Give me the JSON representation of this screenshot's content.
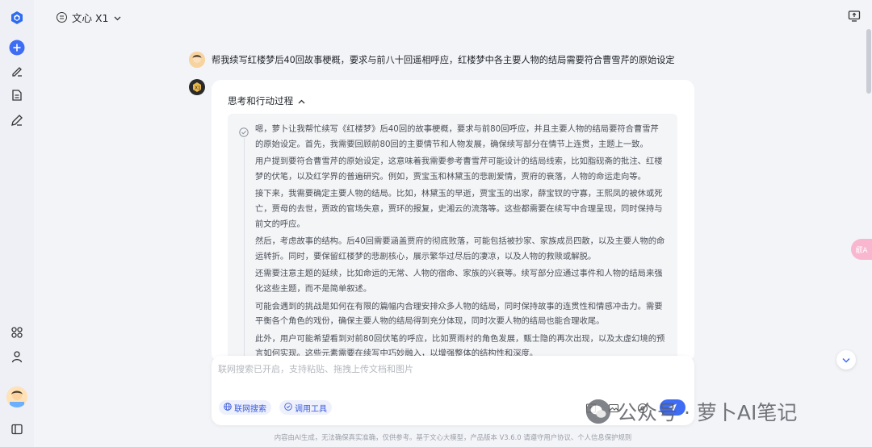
{
  "header": {
    "model_name": "文心 X1"
  },
  "user_message": {
    "text": "帮我续写红楼梦后40回故事梗概，要求与前八十回遥相呼应，红楼梦中各主要人物的结局需要符合曹雪芹的原始设定"
  },
  "thinking": {
    "title": "思考和行动过程",
    "paragraphs": [
      "嗯，萝卜让我帮忙续写《红楼梦》后40回的故事梗概，要求与前80回呼应，并且主要人物的结局要符合曹雪芹的原始设定。首先，我需要回顾前80回的主要情节和人物发展，确保续写部分在情节上连贯，主题上一致。",
      "用户提到要符合曹雪芹的原始设定，这意味着我需要参考曹雪芹可能设计的结局线索，比如脂砚斋的批注、红楼梦的伏笔，以及红学界的普遍研究。例如，贾宝玉和林黛玉的悲剧爱情，贾府的衰落，人物的命运走向等。",
      "接下来，我需要确定主要人物的结局。比如，林黛玉的早逝，贾宝玉的出家，薛宝钗的守寡，王熙凤的被休或死亡，贾母的去世，贾政的官场失意，贾环的报复，史湘云的流落等。这些都需要在续写中合理呈现，同时保持与前文的呼应。",
      "然后，考虑故事的结构。后40回需要涵盖贾府的彻底败落，可能包括被抄家、家族成员四散，以及主要人物的命运转折。同时，要保留红楼梦的悲剧核心，展示繁华过尽后的凄凉，以及人物的救赎或解脱。",
      "还需要注意主题的延续，比如命运的无常、人物的宿命、家族的兴衰等。续写部分应通过事件和人物的结局来强化这些主题，而不是简单叙述。",
      "可能会遇到的挑战是如何在有限的篇幅内合理安排众多人物的结局，同时保持故事的连贯性和情感冲击力。需要平衡各个角色的戏份，确保主要人物的结局得到充分体现，同时次要人物的结局也能合理收尾。",
      "此外，用户可能希望看到对前80回伏笔的呼应，比如贾雨村的角色发展，甄士隐的再次出现，以及太虚幻境的预言如何实现。这些元素需要在续写中巧妙融入，以增强整体的结构性和深度。"
    ]
  },
  "composer": {
    "placeholder": "联网搜索已开启，支持粘贴、拖拽上传文档和图片",
    "chip_web": "联网搜索",
    "chip_tools": "调用工具"
  },
  "watermark": {
    "text": "公众号 · 萝卜AI笔记"
  },
  "float_badge": {
    "text": "㕡A"
  },
  "footer": {
    "text": "内容由AI生成，无法确保真实准确，仅供参考。基于文心大模型，产品版本 V3.6.0 请遵守用户协议、个人信息保护规则"
  },
  "colors": {
    "accent": "#3e6cf5",
    "card_bg": "#ffffff",
    "page_bg": "#f3f4f8",
    "think_bg": "#f4f5f7"
  }
}
